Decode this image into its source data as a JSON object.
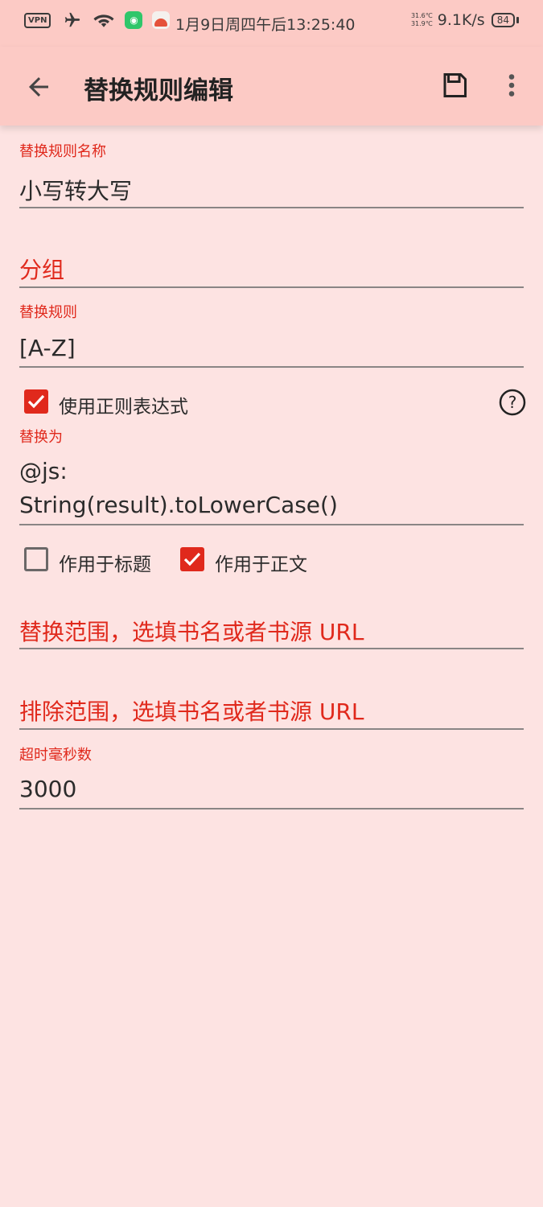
{
  "status_bar": {
    "vpn_label": "VPN",
    "datetime": "1月9日周四午后13:25:40",
    "temp_1": "31.6℃",
    "temp_2": "31.9℃",
    "net_speed": "9.1K/s",
    "battery": "84",
    "icons": [
      "airplane-icon",
      "wifi-icon",
      "wechat-icon",
      "app-icon"
    ]
  },
  "toolbar": {
    "title": "替换规则编辑",
    "back_icon": "arrow-back-icon",
    "save_icon": "save-icon",
    "more_icon": "more-vert-icon"
  },
  "form": {
    "name": {
      "label": "替换规则名称",
      "value": "小写转大写"
    },
    "group": {
      "placeholder": "分组"
    },
    "pattern": {
      "label": "替换规则",
      "value": "[A-Z]"
    },
    "use_regex": {
      "label": "使用正则表达式",
      "checked": true
    },
    "replacement": {
      "label": "替换为",
      "line1": "@js:",
      "line2": "String(result).toLowerCase()"
    },
    "apply_title": {
      "label": "作用于标题",
      "checked": false
    },
    "apply_content": {
      "label": "作用于正文",
      "checked": true
    },
    "scope": {
      "placeholder": "替换范围，选填书名或者书源 URL"
    },
    "exclude": {
      "placeholder": "排除范围，选填书名或者书源 URL"
    },
    "timeout": {
      "label": "超时毫秒数",
      "value": "3000"
    }
  },
  "colors": {
    "accent": "#e0291c",
    "toolbar_bg": "#fccac5",
    "page_bg": "#fde3e2"
  }
}
